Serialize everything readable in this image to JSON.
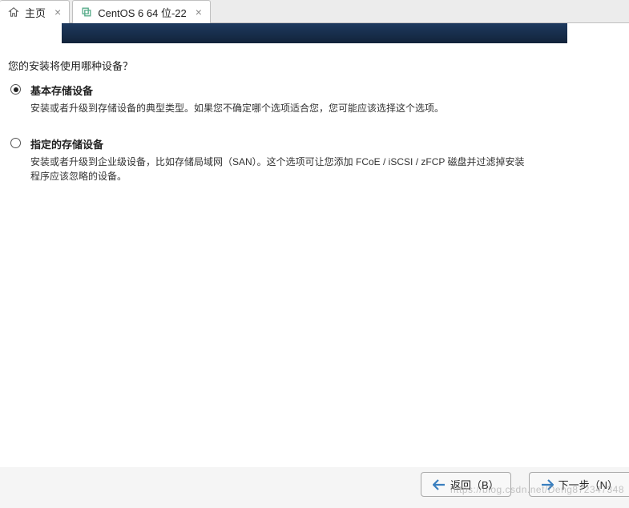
{
  "tabs": {
    "home": {
      "label": "主页"
    },
    "vm": {
      "label": "CentOS 6 64 位-22"
    }
  },
  "installer": {
    "question": "您的安装将使用哪种设备？",
    "options": {
      "basic": {
        "title": "基本存储设备",
        "desc": "安装或者升级到存储设备的典型类型。如果您不确定哪个选项适合您，您可能应该选择这个选项。"
      },
      "specialized": {
        "title": "指定的存储设备",
        "desc": "安装或者升级到企业级设备，比如存储局域网（SAN）。这个选项可让您添加 FCoE / iSCSI / zFCP 磁盘并过滤掉安装程序应该忽略的设备。"
      }
    },
    "buttons": {
      "back": "返回（B）",
      "next": "下一步（N）"
    }
  },
  "watermark": "https://blog.csdn.net/Deng872347348"
}
